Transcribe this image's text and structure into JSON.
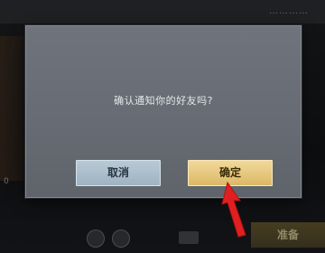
{
  "background": {
    "topbar_text": "…………",
    "left_count": "0",
    "ready_label": "准备"
  },
  "dialog": {
    "message": "确认通知你的好友吗?",
    "cancel_label": "取消",
    "confirm_label": "确定"
  },
  "annotation": {
    "arrow_color": "#e02020",
    "arrow_icon": "red-arrow-icon"
  },
  "colors": {
    "dialog_bg": "#6a6f77",
    "cancel_button": "#a9bccb",
    "confirm_button": "#e6c77b"
  }
}
